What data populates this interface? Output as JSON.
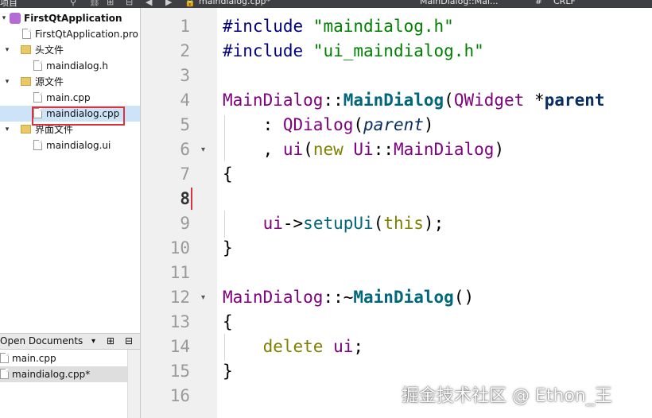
{
  "toolbar": {
    "left_label": "项目",
    "tab_title": "maindialog.cpp*",
    "symbol_label": "MainDialog::Mai...",
    "hash": "#",
    "encoding": "CRLF"
  },
  "project_tree": {
    "project_name": "FirstQtApplication",
    "items": [
      {
        "label": "FirstQtApplication.pro"
      },
      {
        "label": "头文件"
      },
      {
        "label": "maindialog.h"
      },
      {
        "label": "源文件"
      },
      {
        "label": "main.cpp"
      },
      {
        "label": "maindialog.cpp"
      },
      {
        "label": "界面文件"
      },
      {
        "label": "maindialog.ui"
      }
    ]
  },
  "open_documents": {
    "title": "Open Documents",
    "docs": [
      {
        "label": "main.cpp"
      },
      {
        "label": "maindialog.cpp*"
      }
    ]
  },
  "editor": {
    "current_line": 8,
    "line_numbers": [
      "1",
      "2",
      "3",
      "4",
      "5",
      "6",
      "7",
      "8",
      "9",
      "10",
      "11",
      "12",
      "13",
      "14",
      "15",
      "16"
    ],
    "lines": {
      "l1a": "#include ",
      "l1b": "\"maindialog.h\"",
      "l2a": "#include ",
      "l2b": "\"ui_maindialog.h\"",
      "l4a": "MainDialog",
      "l4b": "::",
      "l4c": "MainDialog",
      "l4d": "(",
      "l4e": "QWidget",
      "l4f": " *",
      "l4g": "parent",
      "l5a": "    : ",
      "l5b": "QDialog",
      "l5c": "(",
      "l5d": "parent",
      "l5e": ")",
      "l6a": "    , ",
      "l6b": "ui",
      "l6c": "(",
      "l6d": "new",
      "l6e": " ",
      "l6f": "Ui",
      "l6g": "::",
      "l6h": "MainDialog",
      "l6i": ")",
      "l7": "{",
      "l9a": "    ",
      "l9b": "ui",
      "l9c": "->",
      "l9d": "setupUi",
      "l9e": "(",
      "l9f": "this",
      "l9g": ");",
      "l10": "}",
      "l12a": "MainDialog",
      "l12b": "::~",
      "l12c": "MainDialog",
      "l12d": "()",
      "l13": "{",
      "l14a": "    ",
      "l14b": "delete",
      "l14c": " ",
      "l14d": "ui",
      "l14e": ";",
      "l15": "}"
    }
  },
  "watermark": "掘金技术社区 @ Ethon_王"
}
